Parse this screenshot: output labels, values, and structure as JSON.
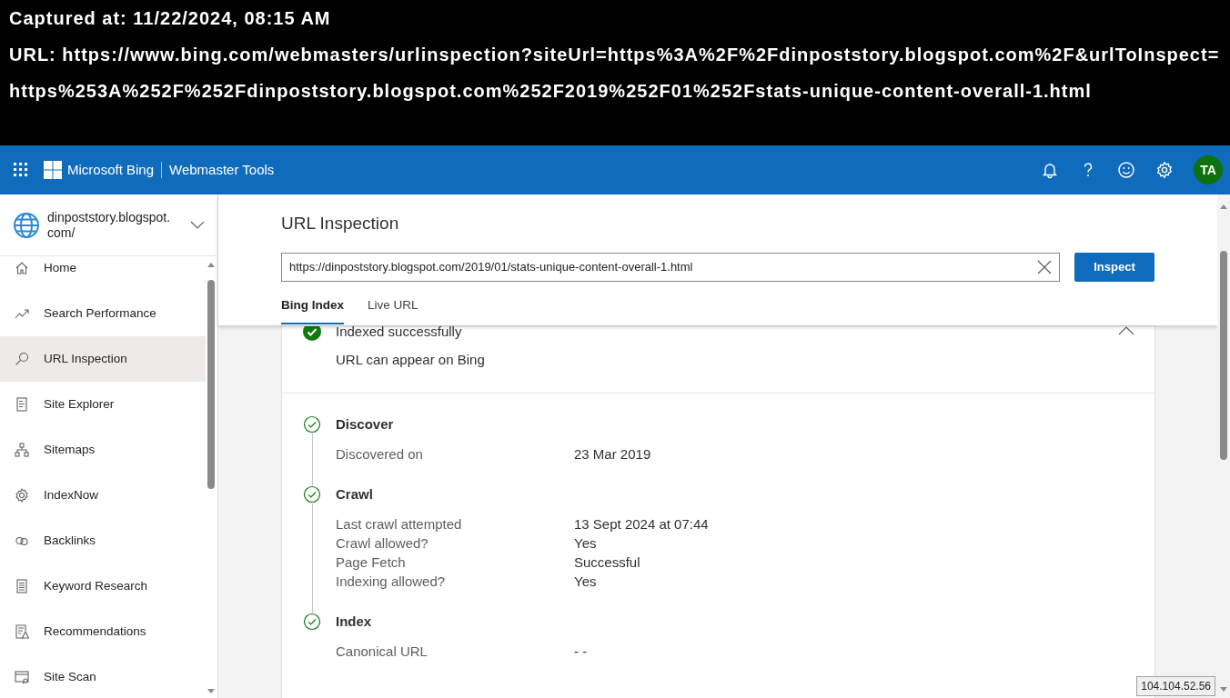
{
  "capture": {
    "captured_at": "Captured at: 11/22/2024, 08:15 AM",
    "url": "URL: https://www.bing.com/webmasters/urlinspection?siteUrl=https%3A%2F%2Fdinpoststory.blogspot.com%2F&urlToInspect=https%253A%252F%252Fdinpoststory.blogspot.com%252F2019%252F01%252Fstats-unique-content-overall-1.html"
  },
  "topbar": {
    "brand": "Microsoft Bing",
    "product": "Webmaster Tools",
    "avatar": "TA"
  },
  "sidebar": {
    "site": "dinpoststory.blogspot.com/",
    "items": [
      {
        "label": "Home",
        "kind": "home",
        "selected": false
      },
      {
        "label": "Search Performance",
        "kind": "performance",
        "selected": false
      },
      {
        "label": "URL Inspection",
        "kind": "inspection",
        "selected": true
      },
      {
        "label": "Site Explorer",
        "kind": "explorer",
        "selected": false
      },
      {
        "label": "Sitemaps",
        "kind": "sitemaps",
        "selected": false
      },
      {
        "label": "IndexNow",
        "kind": "indexnow",
        "selected": false
      },
      {
        "label": "Backlinks",
        "kind": "backlinks",
        "selected": false
      },
      {
        "label": "Keyword Research",
        "kind": "keywords",
        "selected": false
      },
      {
        "label": "Recommendations",
        "kind": "recommendations",
        "selected": false
      },
      {
        "label": "Site Scan",
        "kind": "scan",
        "selected": false
      }
    ]
  },
  "page": {
    "title": "URL Inspection",
    "url_field": {
      "value": "https://dinpoststory.blogspot.com/2019/01/stats-unique-content-overall-1.html"
    },
    "button": "Inspect",
    "tabs": [
      {
        "label": "Bing Index",
        "selected": true
      },
      {
        "label": "Live URL",
        "selected": false
      }
    ]
  },
  "status": {
    "title": "Indexed successfully",
    "subtitle": "URL can appear on Bing",
    "expanded": true
  },
  "sections": [
    {
      "title": "Discover",
      "rows": [
        {
          "label": "Discovered on",
          "value": "23 Mar 2019"
        }
      ]
    },
    {
      "title": "Crawl",
      "rows": [
        {
          "label": "Last crawl attempted",
          "value": "13 Sept 2024 at 07:44"
        },
        {
          "label": "Crawl allowed?",
          "value": "Yes"
        },
        {
          "label": "Page Fetch",
          "value": "Successful"
        },
        {
          "label": "Indexing allowed?",
          "value": "Yes"
        }
      ]
    },
    {
      "title": "Index",
      "rows": [
        {
          "label": "Canonical URL",
          "value": "- -"
        }
      ]
    }
  ],
  "ip_badge": "104.104.52.56"
}
